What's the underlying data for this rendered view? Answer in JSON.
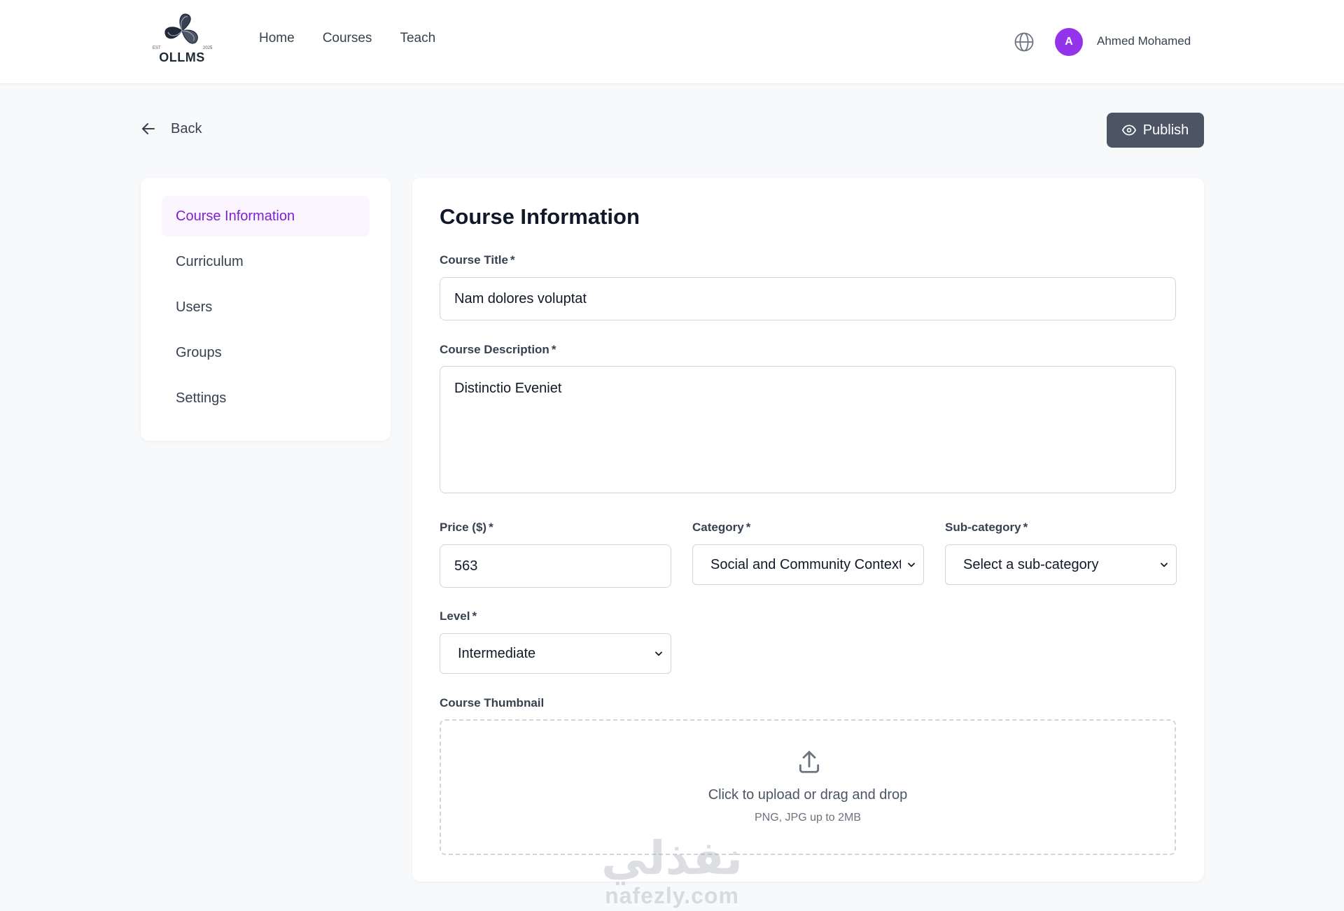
{
  "header": {
    "logo_text": "OLLMS",
    "logo_small_left": "EST",
    "logo_small_right": "2025",
    "nav": [
      {
        "label": "Home"
      },
      {
        "label": "Courses"
      },
      {
        "label": "Teach"
      }
    ],
    "avatar_initial": "A",
    "user_name": "Ahmed Mohamed"
  },
  "toolbar": {
    "back_label": "Back",
    "publish_label": "Publish"
  },
  "sidebar": {
    "items": [
      {
        "label": "Course Information",
        "active": true
      },
      {
        "label": "Curriculum",
        "active": false
      },
      {
        "label": "Users",
        "active": false
      },
      {
        "label": "Groups",
        "active": false
      },
      {
        "label": "Settings",
        "active": false
      }
    ]
  },
  "form": {
    "title": "Course Information",
    "required_mark": "*",
    "course_title": {
      "label": "Course Title",
      "value": "Nam dolores voluptat"
    },
    "course_description": {
      "label": "Course Description",
      "value": "Distinctio Eveniet"
    },
    "price": {
      "label": "Price ($)",
      "value": "563"
    },
    "category": {
      "label": "Category",
      "value": "Social and Community Context"
    },
    "sub_category": {
      "label": "Sub-category",
      "value": "Select a sub-category"
    },
    "level": {
      "label": "Level",
      "value": "Intermediate"
    },
    "thumbnail": {
      "label": "Course Thumbnail",
      "upload_text": "Click to upload or drag and drop",
      "upload_hint": "PNG, JPG up to 2MB"
    }
  },
  "watermark": {
    "arabic": "نفذلي",
    "latin": "nafezly.com"
  },
  "colors": {
    "accent": "#7e22ce",
    "accent_bg": "#faf5ff",
    "avatar": "#9333ea",
    "publish_bg": "#4b5563",
    "page_bg": "#f8f9fb"
  },
  "icons": {
    "globe": "globe-icon",
    "back": "arrow-left-icon",
    "publish": "eye-icon",
    "dropdown": "chevron-down-icon",
    "upload": "upload-icon"
  }
}
